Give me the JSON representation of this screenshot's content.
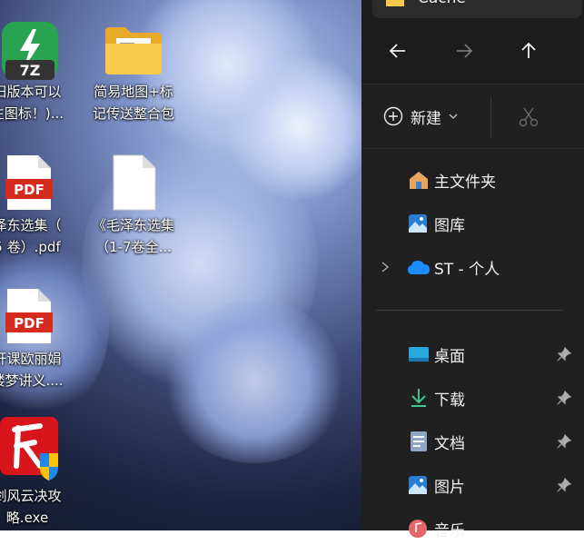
{
  "desktop": {
    "icons": [
      {
        "name": "7zip-icon",
        "label_line1": "旧版本可以",
        "label_line2": "生图标！)..."
      },
      {
        "name": "folder-icon",
        "label_line1": "简易地图+标",
        "label_line2": "记传送整合包"
      },
      {
        "name": "pdf-icon",
        "badge": "PDF",
        "label_line1": "泽东选集（",
        "label_line2": "5 卷）.pdf"
      },
      {
        "name": "blank-file-icon",
        "label_line1": "《毛泽东选集",
        "label_line2": "（1-7卷全..."
      },
      {
        "name": "pdf-icon",
        "badge": "PDF",
        "label_line1": "开课欧丽娟",
        "label_line2": "楼梦讲义...."
      },
      {
        "name": "game-exe-icon",
        "label_line1": "剑风云决攻",
        "label_line2": "略.exe"
      }
    ],
    "sevenzip_badge": "7Z"
  },
  "explorer": {
    "tab_title": "Cache",
    "toolbar": {
      "new_label": "新建"
    },
    "nav": {
      "home": "主文件夹",
      "gallery": "图库",
      "onedrive": "ST - 个人",
      "desktop": "桌面",
      "downloads": "下载",
      "documents": "文档",
      "pictures": "图片",
      "music": "音乐"
    },
    "colors": {
      "background": "#202020",
      "accent": "#60cdff"
    }
  }
}
